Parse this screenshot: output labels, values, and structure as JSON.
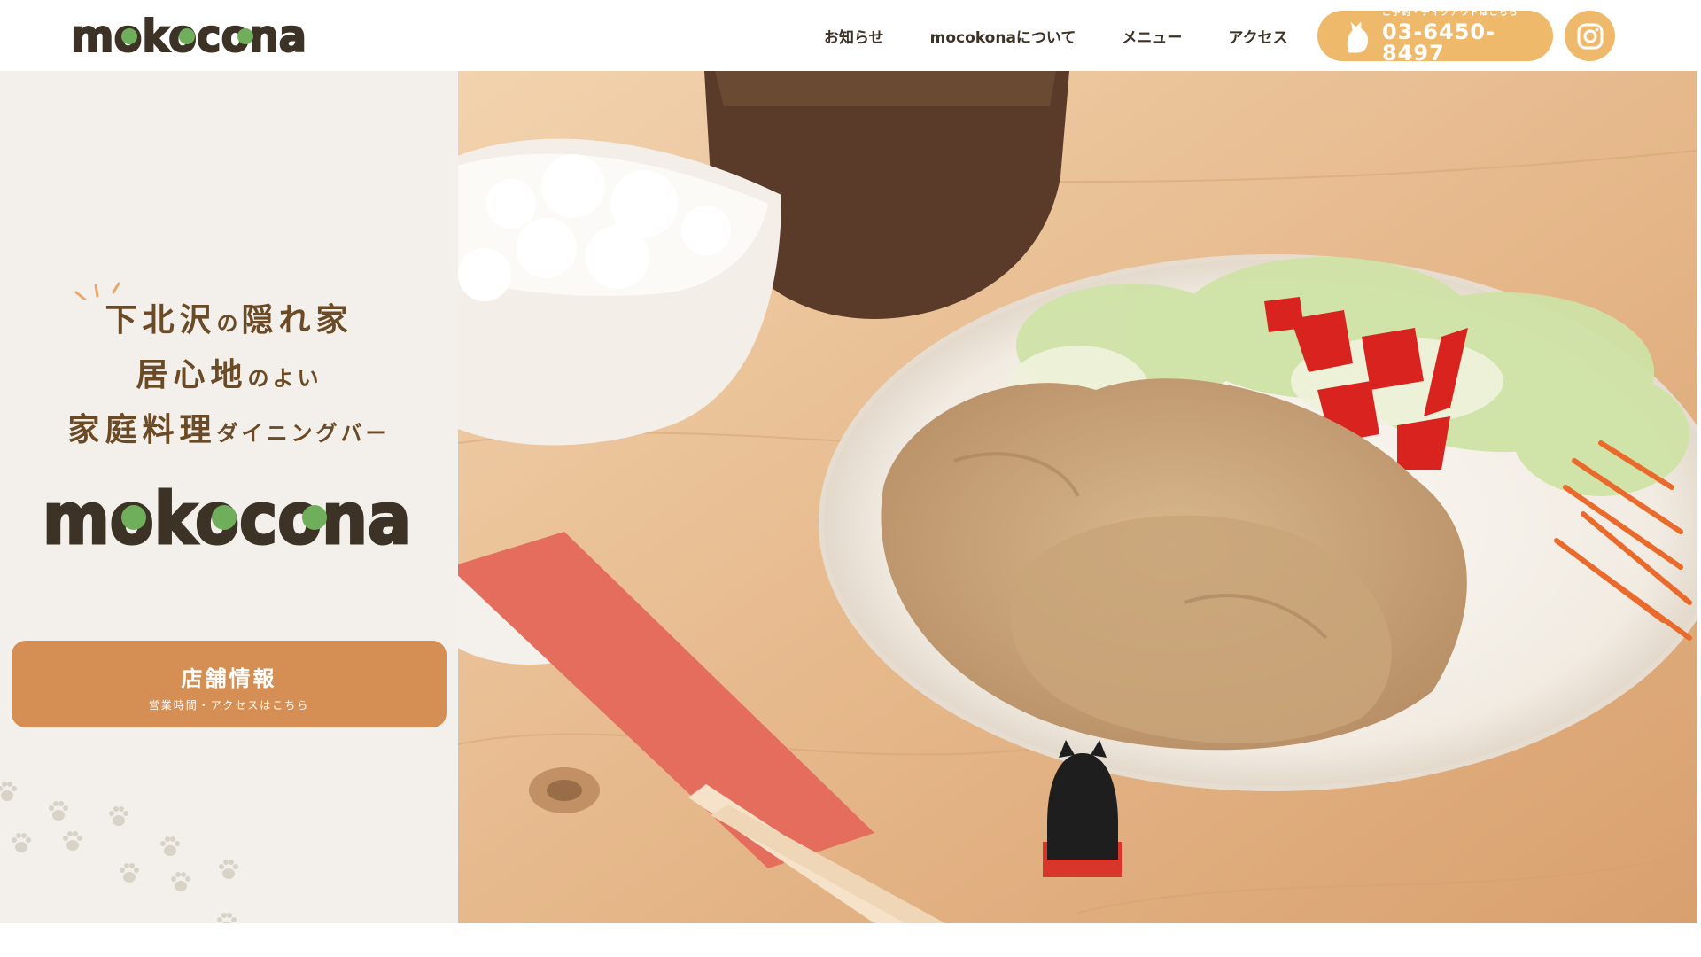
{
  "header": {
    "logo_text": "mokocona",
    "nav": [
      {
        "label": "お知らせ"
      },
      {
        "label": "mocokonaについて"
      },
      {
        "label": "メニュー"
      },
      {
        "label": "アクセス"
      }
    ],
    "tel": {
      "caption": "ご予約・テイクアウトはこちら",
      "number": "03-6450-8497",
      "icon": "cat-silhouette-icon"
    },
    "instagram_icon": "instagram-icon"
  },
  "hero": {
    "tagline": {
      "line1": {
        "big1": "下北沢",
        "small": "の",
        "big2": "隠れ家"
      },
      "line2": {
        "big": "居心地",
        "small": "のよい"
      },
      "line3": {
        "big": "家庭料理",
        "small": "ダイニングバー"
      }
    },
    "logo_text": "mokocona",
    "store_button": {
      "title": "店舗情報",
      "subtitle": "営業時間・アクセスはこちら"
    },
    "photo_alt_icon": "ginger-pork-meal-photo"
  },
  "colors": {
    "accent_orange": "#efb96b",
    "button_brown": "#d58f54",
    "panel_bg": "#f3f0eb",
    "text_dark": "#3d3226",
    "tagline_brown": "#6b4a26",
    "logo_green": "#6fae5b"
  }
}
